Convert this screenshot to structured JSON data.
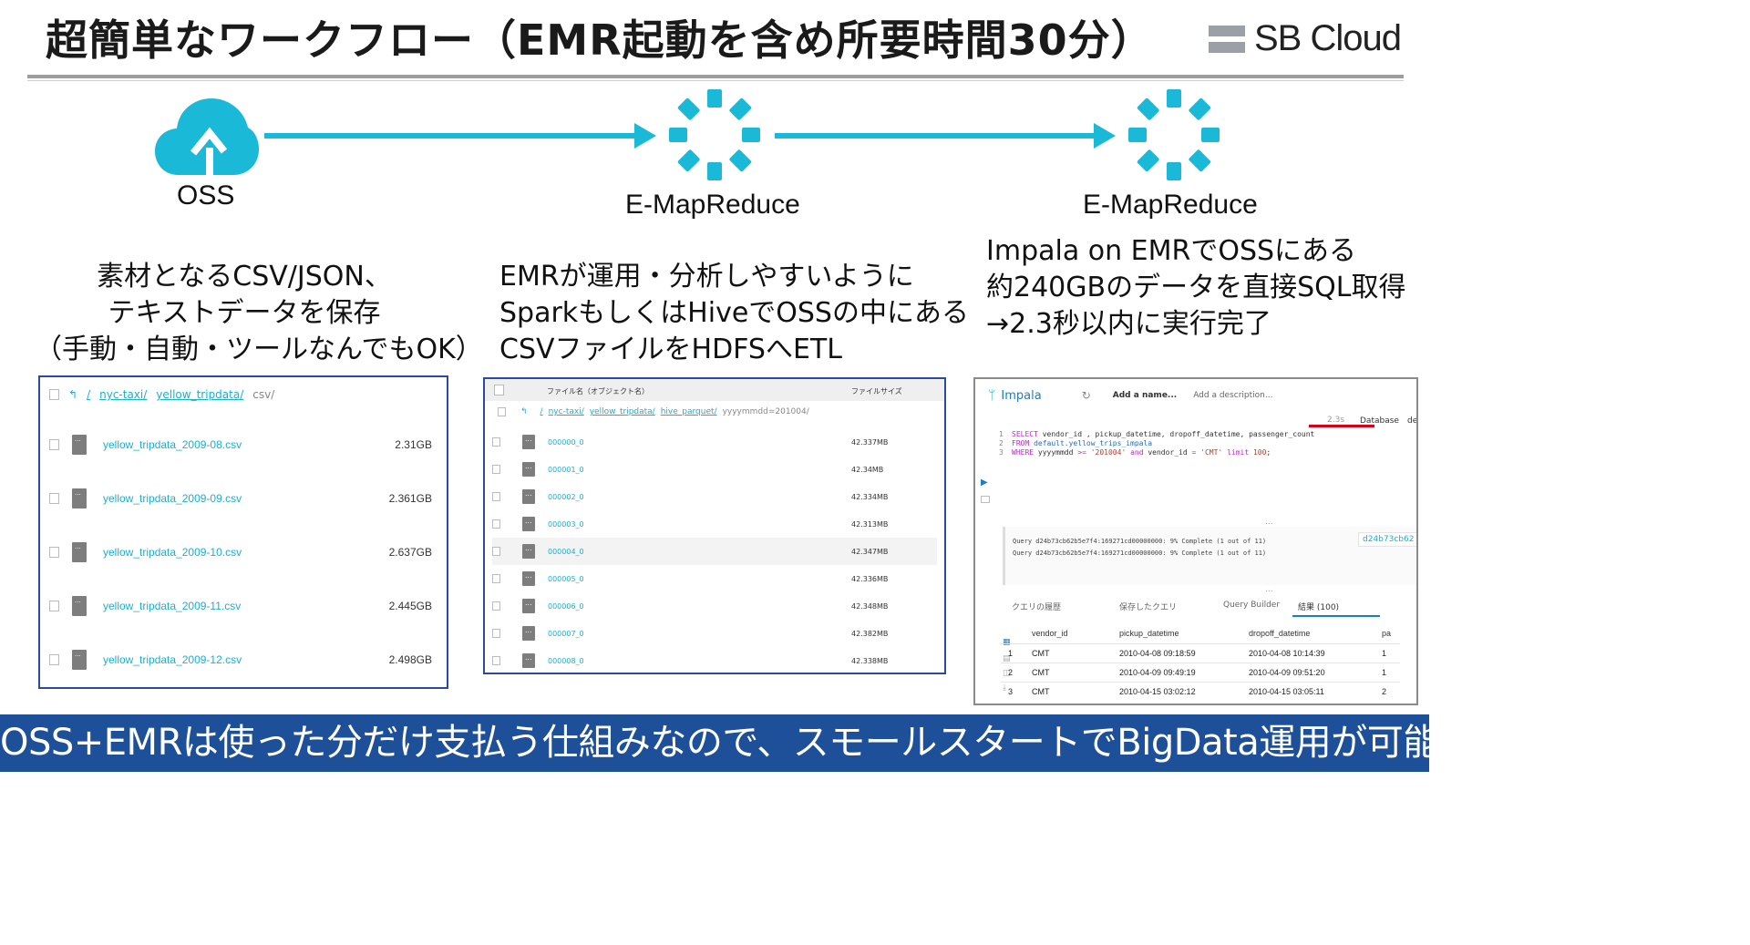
{
  "title": "超簡単なワークフロー（EMR起動を含め所要時間30分）",
  "brand": "SB Cloud",
  "colors": {
    "accent": "#1ab9d8",
    "banner": "#1e4f99",
    "panel_border": "#2a4a9a"
  },
  "nodes": [
    {
      "label": "OSS",
      "icon": "cloud-upload-icon"
    },
    {
      "label": "E-MapReduce",
      "icon": "emr-spinner-icon"
    },
    {
      "label": "E-MapReduce",
      "icon": "emr-spinner-icon"
    }
  ],
  "descriptions": [
    [
      "素材となるCSV/JSON、",
      "テキストデータを保存",
      "（手動・自動・ツールなんでもOK）"
    ],
    [
      "EMRが運用・分析しやすいように",
      "SparkもしくはHiveでOSSの中にある",
      "CSVファイルをHDFSへETL"
    ],
    [
      "Impala on EMRでOSSにある",
      "約240GBのデータを直接SQL取得",
      "→2.3秒以内に実行完了"
    ]
  ],
  "oss_panel": {
    "breadcrumb": [
      "/",
      "nyc-taxi/",
      "yellow_tripdata/",
      "csv/"
    ],
    "files": [
      {
        "name": "yellow_tripdata_2009-08.csv",
        "size": "2.31GB"
      },
      {
        "name": "yellow_tripdata_2009-09.csv",
        "size": "2.361GB"
      },
      {
        "name": "yellow_tripdata_2009-10.csv",
        "size": "2.637GB"
      },
      {
        "name": "yellow_tripdata_2009-11.csv",
        "size": "2.445GB"
      },
      {
        "name": "yellow_tripdata_2009-12.csv",
        "size": "2.498GB"
      }
    ]
  },
  "hdfs_panel": {
    "col_name": "ファイル名（オブジェクト名）",
    "col_size": "ファイルサイズ",
    "path": [
      "/",
      "nyc-taxi/",
      "yellow_tripdata/",
      "hive_parquet/",
      "yyyymmdd=201004/"
    ],
    "files": [
      {
        "name": "000000_0",
        "size": "42.337MB"
      },
      {
        "name": "000001_0",
        "size": "42.34MB"
      },
      {
        "name": "000002_0",
        "size": "42.334MB"
      },
      {
        "name": "000003_0",
        "size": "42.313MB"
      },
      {
        "name": "000004_0",
        "size": "42.347MB"
      },
      {
        "name": "000005_0",
        "size": "42.336MB"
      },
      {
        "name": "000006_0",
        "size": "42.348MB"
      },
      {
        "name": "000007_0",
        "size": "42.382MB"
      },
      {
        "name": "000008_0",
        "size": "42.338MB"
      }
    ]
  },
  "impala_panel": {
    "app": "Impala",
    "name_placeholder": "Add a name...",
    "desc_placeholder": "Add a description...",
    "time": "2.3s",
    "database": "Database",
    "database_trunc": "de",
    "sql": {
      "l1_kw": "SELECT",
      "l1_rest": " vendor_id , pickup_datetime, dropoff_datetime, passenger_count",
      "l2_kw": "FROM",
      "l2_rest": " default.yellow_trips_impala",
      "l3_kw": "WHERE",
      "l3_col": " yyyymmdd ",
      "l3_op": ">=",
      "l3_str1": " '201004' ",
      "l3_and": "and",
      "l3_col2": " vendor_id ",
      "l3_eq": "=",
      "l3_str2": " 'CMT' ",
      "l3_limit": "limit",
      "l3_num": " 100",
      "l3_end": ";"
    },
    "log": [
      "Query d24b73cb62b5e7f4:169271cd00000000: 9% Complete (1 out of 11)",
      "Query d24b73cb62b5e7f4:169271cd00000000: 9% Complete (1 out of 11)"
    ],
    "query_id_link": "d24b73cb62",
    "ellipsis": "...",
    "tabs": [
      "クエリの履歴",
      "保存したクエリ",
      "Query Builder",
      "結果 (100)"
    ],
    "columns": [
      "vendor_id",
      "pickup_datetime",
      "dropoff_datetime",
      "pa"
    ],
    "rows": [
      {
        "n": "1",
        "vendor_id": "CMT",
        "pickup": "2010-04-08 09:18:59",
        "dropoff": "2010-04-08 10:14:39",
        "pa": "1"
      },
      {
        "n": "2",
        "vendor_id": "CMT",
        "pickup": "2010-04-09 09:49:19",
        "dropoff": "2010-04-09 09:51:20",
        "pa": "1"
      },
      {
        "n": "3",
        "vendor_id": "CMT",
        "pickup": "2010-04-15 03:02:12",
        "dropoff": "2010-04-15 03:05:11",
        "pa": "2"
      }
    ]
  },
  "footer": "OSS+EMRは使った分だけ支払う仕組みなので、スモールスタートでBigData運用が可能"
}
